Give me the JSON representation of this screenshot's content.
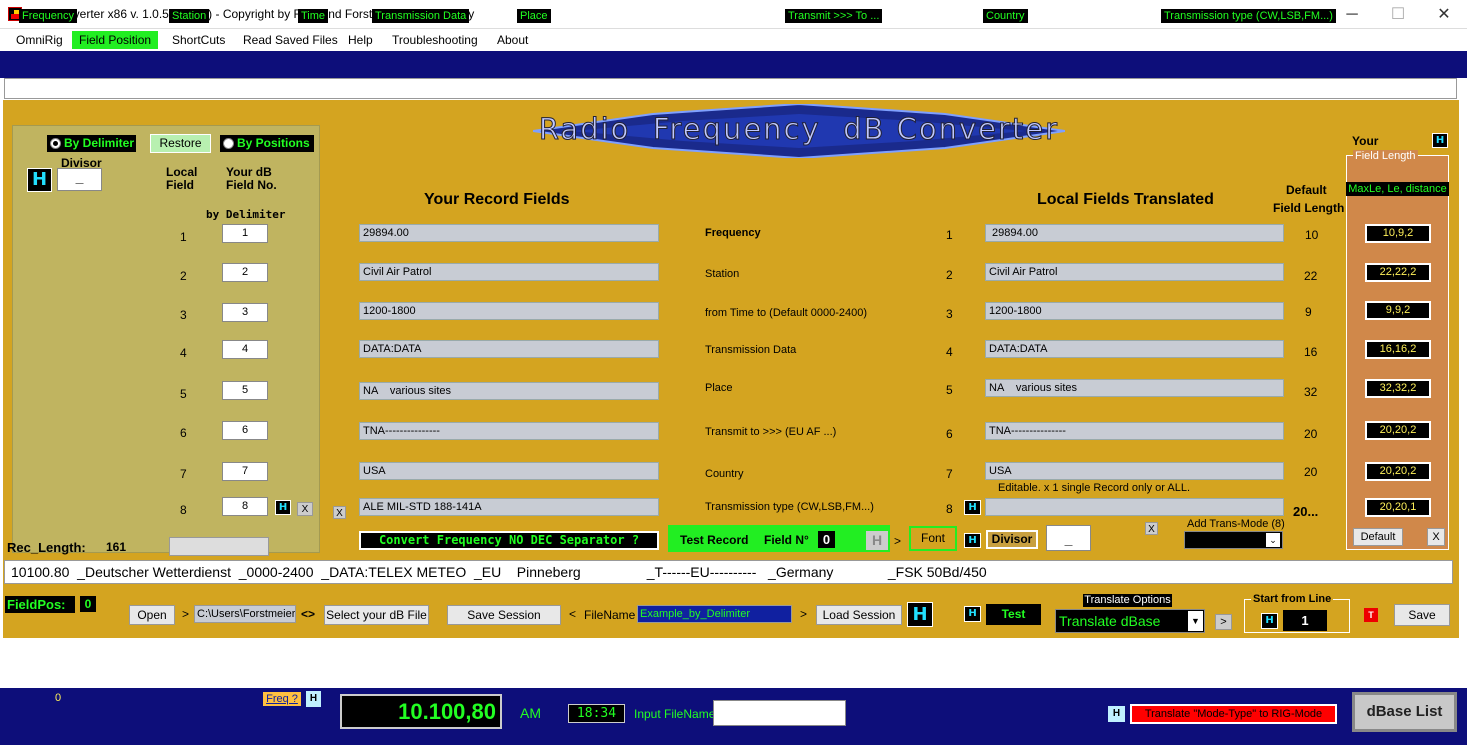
{
  "window": {
    "title": "RFRConverter x86 v. 1.0.5 (fw 3.5) - Copyright by Raimund Forstmeier, Padova/Italy",
    "minimize": "─",
    "maximize": "☐",
    "close": "✕"
  },
  "menu": [
    "OmniRig",
    "Field Position",
    "ShortCuts",
    "Read Saved Files",
    "Help",
    "Troubleshooting",
    "About"
  ],
  "headers": [
    "Frequency",
    "Station",
    "Time",
    "Transmission Data",
    "Place",
    "Transmit >>> To ...",
    "Country",
    "Transmission type (CW,LSB,FM...)"
  ],
  "logo": "Radio  Frequency  dB Converter",
  "left": {
    "by_delimiter": "By Delimiter",
    "restore": "Restore",
    "by_positions": "By Positions",
    "divisor_label": "Divisor",
    "divisor_value": "_",
    "h": "H",
    "local_field": "Local\nField",
    "your_db": "Your dB\nField No.",
    "by_delim_label": "by Delimiter",
    "rows": [
      "1",
      "2",
      "3",
      "4",
      "5",
      "6",
      "7",
      "8"
    ],
    "inputs": [
      "1",
      "2",
      "3",
      "4",
      "5",
      "6",
      "7",
      "8"
    ],
    "x": "X"
  },
  "center": {
    "your_record_fields": "Your Record Fields",
    "local_fields_translated": "Local Fields Translated",
    "default_label": "Default",
    "field_length_label": "Field Length",
    "records": [
      "29894.00",
      "Civil Air Patrol",
      "1200-1800",
      "DATA:DATA",
      "NA    various sites",
      "TNA---------------",
      "USA",
      "ALE MIL-STD 188-141A"
    ],
    "field_names": [
      "Frequency",
      "Station",
      "from Time to (Default 0000-2400)",
      "Transmission Data",
      "Place",
      "Transmit to >>> (EU AF ...)",
      "Country",
      "Transmission type (CW,LSB,FM...)"
    ],
    "nums": [
      "1",
      "2",
      "3",
      "4",
      "5",
      "6",
      "7",
      "8"
    ],
    "translated": [
      " 29894.00",
      "Civil Air Patrol",
      "1200-1800",
      "DATA:DATA",
      "NA    various sites",
      "TNA---------------",
      "USA",
      ""
    ],
    "defaults": [
      "10",
      "22",
      "9",
      "16",
      "32",
      "20",
      "20",
      "20..."
    ],
    "editable_note": "Editable. x 1 single Record only or ALL.",
    "x": "X"
  },
  "right": {
    "your": "Your",
    "field_length": "Field Length",
    "maxle": "MaxLe, Le, distance",
    "values": [
      "10,9,2",
      "22,22,2",
      "9,9,2",
      "16,16,2",
      "32,32,2",
      "20,20,2",
      "20,20,2",
      "20,20,1"
    ],
    "default_btn": "Default",
    "x": "X"
  },
  "toolbar": {
    "convert": "Convert Frequency NO DEC Separator ?",
    "test_record": "Test Record",
    "field_n": "Field N°",
    "field_n_val": "0",
    "h": "H",
    "gt": ">",
    "font": "Font",
    "divisor": "Divisor",
    "divisor_val": "_",
    "x": "X",
    "add_trans_mode": "Add Trans-Mode (8)",
    "rec_length_label": "Rec_Length:",
    "rec_length_val": "161"
  },
  "status_line": "10100.80  _Deutscher Wetterdienst  _0000-2400  _DATA:TELEX METEO  _EU    Pinneberg                 _T------EU----------   _Germany              _FSK 50Bd/450",
  "actions": {
    "fieldpos": "FieldPos:",
    "fieldpos_val": "0",
    "open": "Open",
    "gt": ">",
    "path": "C:\\Users\\Forstmeier",
    "swap": "<>",
    "select_db": "Select your dB File",
    "save_session": "Save Session",
    "lt": "<",
    "filename_label": "FileName",
    "filename": "Example_by_Delimiter",
    "load_session": "Load Session",
    "h": "H",
    "test": "Test",
    "translate_options": "Translate Options",
    "translate_dbase": "Translate dBase",
    "start_from_line": "Start from Line",
    "start_val": "1",
    "t": "T",
    "save": "Save"
  },
  "bottom": {
    "zero": "0",
    "freq_q": "Freq ?",
    "h": "H",
    "freq_display": "10.100,80",
    "mode": "AM",
    "time": "18:34",
    "input_filename": "Input FileName",
    "translate_mode": "Translate \"Mode-Type\" to RIG-Mode",
    "dbase_list": "dBase List"
  },
  "colors": {
    "accent_green": "#22ff22",
    "panel_gold": "#d4a420",
    "navy": "#0d0e7a"
  }
}
